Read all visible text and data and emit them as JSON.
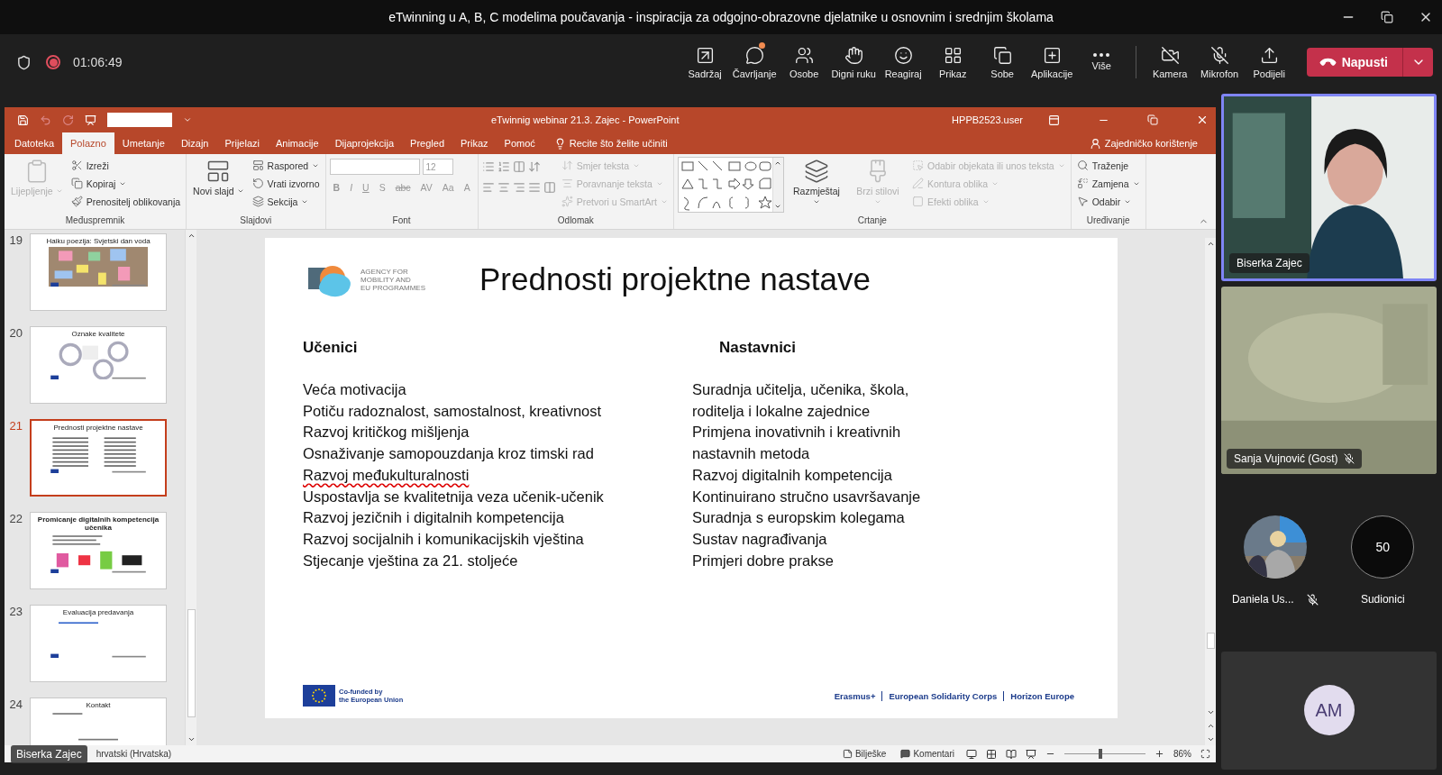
{
  "window": {
    "title": "eTwinning u A, B, C modelima poučavanja - inspiracija za odgojno-obrazovne djelatnike u osnovnim i srednjim školama"
  },
  "meeting_bar": {
    "timer": "01:06:49",
    "actions": [
      {
        "label": "Sadržaj",
        "notification": false
      },
      {
        "label": "Čavrljanje",
        "notification": true
      },
      {
        "label": "Osobe",
        "notification": false
      },
      {
        "label": "Digni ruku",
        "notification": false
      },
      {
        "label": "Reagiraj",
        "notification": false
      },
      {
        "label": "Prikaz",
        "notification": false
      },
      {
        "label": "Sobe",
        "notification": false
      },
      {
        "label": "Aplikacije",
        "notification": false
      },
      {
        "label": "Više",
        "notification": false
      }
    ],
    "devices": [
      {
        "label": "Kamera"
      },
      {
        "label": "Mikrofon"
      },
      {
        "label": "Podijeli"
      }
    ],
    "leave": "Napusti"
  },
  "powerpoint": {
    "title": "eTwinnig webinar 21.3. Zajec  -  PowerPoint",
    "user": "HPPB2523.user",
    "tabs": [
      {
        "label": "Datoteka",
        "selected": false
      },
      {
        "label": "Polazno",
        "selected": true
      },
      {
        "label": "Umetanje",
        "selected": false
      },
      {
        "label": "Dizajn",
        "selected": false
      },
      {
        "label": "Prijelazi",
        "selected": false
      },
      {
        "label": "Animacije",
        "selected": false
      },
      {
        "label": "Dijaprojekcija",
        "selected": false
      },
      {
        "label": "Pregled",
        "selected": false
      },
      {
        "label": "Prikaz",
        "selected": false
      },
      {
        "label": "Pomoć",
        "selected": false
      }
    ],
    "tell_me": "Recite što želite učiniti",
    "share": "Zajedničko korištenje",
    "ribbon_groups": [
      {
        "label": "Međuspremnik",
        "kind": "standard",
        "large": [
          {
            "label": "Lijepljenje",
            "disabled": true,
            "dropdown": true
          }
        ],
        "small": [
          {
            "label": "Izreži",
            "disabled": false,
            "dropdown": false
          },
          {
            "label": "Kopiraj",
            "disabled": false,
            "dropdown": true
          },
          {
            "label": "Prenositelj oblikovanja",
            "disabled": false,
            "dropdown": false
          }
        ]
      },
      {
        "label": "Slajdovi",
        "kind": "standard",
        "large": [
          {
            "label": "Novi slajd",
            "disabled": false,
            "dropdown": true
          }
        ],
        "small": [
          {
            "label": "Raspored",
            "disabled": false,
            "dropdown": true
          },
          {
            "label": "Vrati izvorno",
            "disabled": false,
            "dropdown": false
          },
          {
            "label": "Sekcija",
            "disabled": false,
            "dropdown": true
          }
        ]
      },
      {
        "label": "Font",
        "kind": "font",
        "font_size": "12",
        "buttons": [
          "B",
          "I",
          "U",
          "S",
          "abc",
          "AV",
          "Aa",
          "A"
        ]
      },
      {
        "label": "Odlomak",
        "kind": "paragraph",
        "small": [
          {
            "label": "Smjer teksta",
            "disabled": true,
            "dropdown": true
          },
          {
            "label": "Poravnanje teksta",
            "disabled": true,
            "dropdown": true
          },
          {
            "label": "Pretvori u SmartArt",
            "disabled": true,
            "dropdown": true
          }
        ]
      },
      {
        "label": "Crtanje",
        "kind": "drawing",
        "large": [
          {
            "label": "Razmještaj",
            "disabled": false,
            "dropdown": true
          },
          {
            "label": "Brzi stilovi",
            "disabled": true,
            "dropdown": true
          }
        ],
        "small": [
          {
            "label": "Odabir objekata ili unos teksta",
            "disabled": true,
            "dropdown": true
          },
          {
            "label": "Kontura oblika",
            "disabled": true,
            "dropdown": true
          },
          {
            "label": "Efekti oblika",
            "disabled": true,
            "dropdown": true
          }
        ]
      },
      {
        "label": "Uređivanje",
        "kind": "standard",
        "small": [
          {
            "label": "Traženje",
            "disabled": false,
            "dropdown": false
          },
          {
            "label": "Zamjena",
            "disabled": false,
            "dropdown": true
          },
          {
            "label": "Odabir",
            "disabled": false,
            "dropdown": true
          }
        ]
      }
    ],
    "thumbnails": [
      {
        "number": "19",
        "title": "Haiku poezija: Svjetski dan voda",
        "kind": "board",
        "selected": false
      },
      {
        "number": "20",
        "title": "Oznake kvalitete",
        "kind": "badges",
        "selected": false
      },
      {
        "number": "21",
        "title": "Prednosti projektne nastave",
        "kind": "columns",
        "selected": true
      },
      {
        "number": "22",
        "title": "Promicanje digitalnih kompetencija učenika",
        "kind": "logos",
        "selected": false
      },
      {
        "number": "23",
        "title": "Evaluacija predavanja",
        "kind": "link",
        "selected": false
      },
      {
        "number": "24",
        "title": "Kontakt",
        "kind": "plain",
        "selected": false
      }
    ],
    "slide": {
      "logo_text": [
        "AGENCY FOR",
        "MOBILITY AND",
        "EU PROGRAMMES"
      ],
      "title": "Prednosti projektne nastave",
      "columns": [
        {
          "heading": "Učenici",
          "lines": [
            {
              "text": "Veća motivacija",
              "misspelled": false
            },
            {
              "text": "Potiču radoznalost, samostalnost, kreativnost",
              "misspelled": false
            },
            {
              "text": "Razvoj kritičkog mišljenja",
              "misspelled": false
            },
            {
              "text": "Osnaživanje samopouzdanja kroz timski rad",
              "misspelled": false
            },
            {
              "text": "Razvoj međukulturalnosti",
              "misspelled": true
            },
            {
              "text": "Uspostavlja se kvalitetnija veza učenik-učenik",
              "misspelled": false
            },
            {
              "text": "Razvoj jezičnih i digitalnih kompetencija",
              "misspelled": false
            },
            {
              "text": "Razvoj socijalnih i komunikacijskih vještina",
              "misspelled": false
            },
            {
              "text": "Stjecanje vještina za 21. stoljeće",
              "misspelled": false
            }
          ]
        },
        {
          "heading": "Nastavnici",
          "lines": [
            {
              "text": "Suradnja učitelja, učenika, škola,",
              "misspelled": false
            },
            {
              "text": "roditelja i lokalne zajednice",
              "misspelled": false
            },
            {
              "text": "Primjena inovativnih i kreativnih",
              "misspelled": false
            },
            {
              "text": "nastavnih metoda",
              "misspelled": false
            },
            {
              "text": "Razvoj digitalnih kompetencija",
              "misspelled": false
            },
            {
              "text": "Kontinuirano stručno usavršavanje",
              "misspelled": false
            },
            {
              "text": "Suradnja s europskim kolegama",
              "misspelled": false
            },
            {
              "text": "Sustav nagrađivanja",
              "misspelled": false
            },
            {
              "text": "Primjeri dobre prakse",
              "misspelled": false
            }
          ]
        }
      ],
      "eu_text": [
        "Co-funded by",
        "the European Union"
      ],
      "programmes": [
        "Erasmus+",
        "European Solidarity Corps",
        "Horizon Europe"
      ]
    },
    "status_bar": {
      "presenter": "Biserka Zajec",
      "language": "hrvatski (Hrvatska)",
      "notes": "Bilješke",
      "comments": "Komentari",
      "zoom": "86%",
      "zoom_slider": {
        "level": 0.45
      }
    }
  },
  "participants": {
    "tiles": [
      {
        "name": "Biserka Zajec",
        "selected": true,
        "muted": false
      },
      {
        "name": "Sanja Vujnović (Gost)",
        "selected": false,
        "muted": true
      }
    ],
    "avatars": [
      {
        "name": "Daniela Us...",
        "muted": true
      },
      {
        "name": "Sudionici",
        "kind": "count",
        "count": "50",
        "muted": false
      }
    ],
    "bottom_tile": {
      "initials": "AM"
    }
  }
}
